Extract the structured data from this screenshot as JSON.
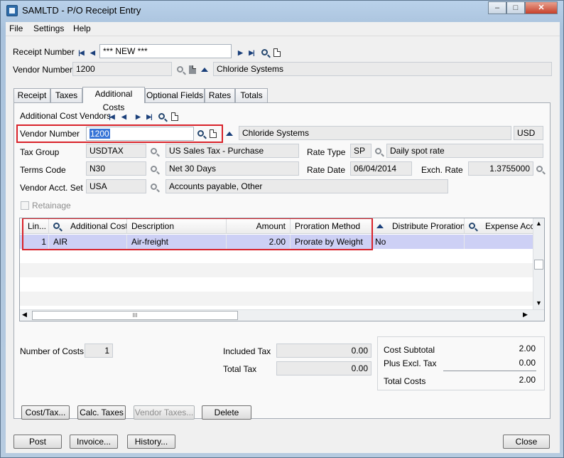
{
  "window": {
    "title": "SAMLTD - P/O Receipt Entry",
    "controls": {
      "minimize": "–",
      "maximize": "□",
      "close": "✕"
    }
  },
  "menu": [
    "File",
    "Settings",
    "Help"
  ],
  "header": {
    "receipt_number_label": "Receipt Number",
    "receipt_number": "*** NEW ***",
    "vendor_number_label": "Vendor Number",
    "vendor_number": "1200",
    "vendor_name": "Chloride Systems"
  },
  "tabs": [
    "Receipt",
    "Taxes",
    "Additional Costs",
    "Optional Fields",
    "Rates",
    "Totals"
  ],
  "active_tab": "Additional Costs",
  "additional_costs": {
    "vendors_label": "Additional Cost Vendors",
    "vendor_number_label": "Vendor Number",
    "vendor_number": "1200",
    "vendor_name": "Chloride Systems",
    "currency": "USD",
    "tax_group_label": "Tax Group",
    "tax_group": "USDTAX",
    "tax_group_desc": "US Sales Tax - Purchase",
    "rate_type_label": "Rate Type",
    "rate_type": "SP",
    "rate_type_desc": "Daily spot rate",
    "terms_code_label": "Terms Code",
    "terms_code": "N30",
    "terms_desc": "Net 30 Days",
    "rate_date_label": "Rate Date",
    "rate_date": "06/04/2014",
    "exch_rate_label": "Exch. Rate",
    "exch_rate": "1.3755000",
    "vendor_acct_set_label": "Vendor Acct. Set",
    "vendor_acct_set": "USA",
    "vendor_acct_set_desc": "Accounts payable, Other",
    "retainage_label": "Retainage"
  },
  "grid": {
    "columns": [
      "Lin...",
      "Additional Cost",
      "Description",
      "Amount",
      "Proration Method",
      "Distribute Proration",
      "Expense Acco"
    ],
    "rows": [
      {
        "line": "1",
        "cost": "AIR",
        "description": "Air-freight",
        "amount": "2.00",
        "proration": "Prorate by Weight",
        "distribute": "No",
        "expense": ""
      }
    ],
    "hscroll_grip": "III"
  },
  "totals": {
    "number_of_costs_label": "Number of Costs",
    "number_of_costs": "1",
    "included_tax_label": "Included Tax",
    "included_tax": "0.00",
    "total_tax_label": "Total Tax",
    "total_tax": "0.00",
    "cost_subtotal_label": "Cost Subtotal",
    "cost_subtotal": "2.00",
    "plus_excl_tax_label": "Plus Excl. Tax",
    "plus_excl_tax": "0.00",
    "total_costs_label": "Total Costs",
    "total_costs": "2.00"
  },
  "tab_buttons": [
    "Cost/Tax...",
    "Calc. Taxes",
    "Vendor Taxes...",
    "Delete"
  ],
  "footer_buttons": [
    "Post",
    "Invoice...",
    "History...",
    "Close"
  ],
  "colors": {
    "highlight_border": "#d9222a",
    "selected_row": "#cdd0f5",
    "window_frame": "#b9d1ea"
  }
}
